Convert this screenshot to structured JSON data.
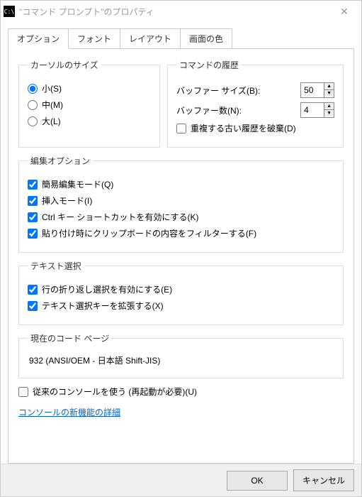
{
  "window": {
    "title": "\"コマンド プロンプト\"のプロパティ",
    "icon_text": "C:\\"
  },
  "tabs": [
    "オプション",
    "フォント",
    "レイアウト",
    "画面の色"
  ],
  "cursor": {
    "legend": "カーソルのサイズ",
    "options": {
      "small": "小(S)",
      "medium": "中(M)",
      "large": "大(L)"
    }
  },
  "history": {
    "legend": "コマンドの履歴",
    "buffer_size_label": "バッファー サイズ(B):",
    "buffer_size_value": "50",
    "buffer_count_label": "バッファー数(N):",
    "buffer_count_value": "4",
    "discard_dup_label": "重複する古い履歴を破棄(D)"
  },
  "edit": {
    "legend": "編集オプション",
    "quick_edit": "簡易編集モード(Q)",
    "insert_mode": "挿入モード(I)",
    "ctrl_shortcuts": "Ctrl キー ショートカットを有効にする(K)",
    "filter_paste": "貼り付け時にクリップボードの内容をフィルターする(F)"
  },
  "textsel": {
    "legend": "テキスト選択",
    "wrap_select": "行の折り返し選択を有効にする(E)",
    "ext_keys": "テキスト選択キーを拡張する(X)"
  },
  "codepage": {
    "legend": "現在のコード ページ",
    "value": "932   (ANSI/OEM - 日本語 Shift-JIS)"
  },
  "legacy": {
    "label": "従来のコンソールを使う (再起動が必要)(U)",
    "link": "コンソールの新機能の詳細"
  },
  "buttons": {
    "ok": "OK",
    "cancel": "キャンセル"
  }
}
